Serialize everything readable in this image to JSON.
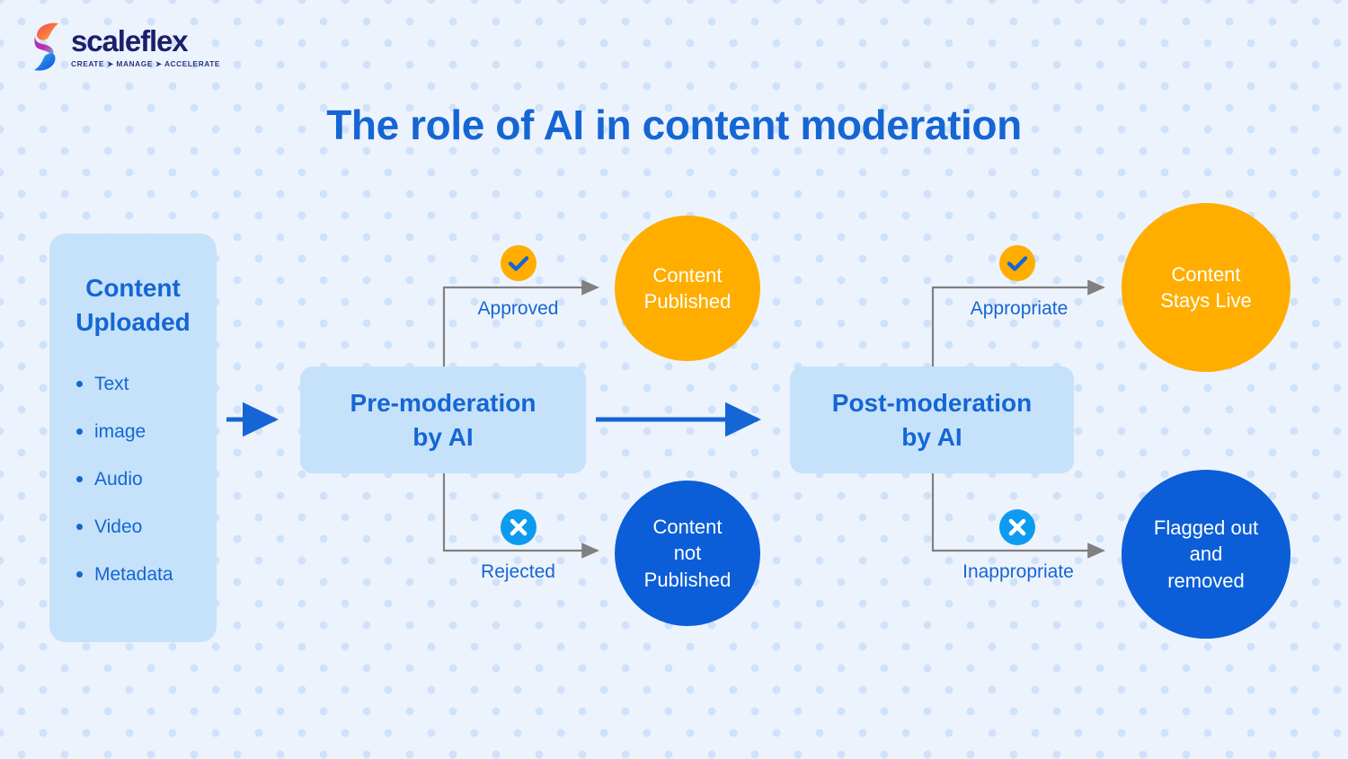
{
  "brand": {
    "logo_icon": "scaleflex-s-logo-icon",
    "wordmark": "scaleflex",
    "tagline": "CREATE ➤ MANAGE ➤ ACCELERATE"
  },
  "page": {
    "title": "The role of AI in content moderation",
    "background_color": "#EDF3FD",
    "dot_color": "#CFE2FA"
  },
  "colors": {
    "primary_blue": "#1566D4",
    "deep_blue": "#0B5ED7",
    "light_blue_fill": "#C6E2FA",
    "orange": "#FFAE00",
    "cyan": "#0D9BF0",
    "connector_gray": "#808080",
    "white": "#FFFFFF"
  },
  "content_card": {
    "title": "Content\nUploaded",
    "title_line1": "Content",
    "title_line2": "Uploaded",
    "items": [
      {
        "label": "Text"
      },
      {
        "label": "image"
      },
      {
        "label": "Audio"
      },
      {
        "label": "Video"
      },
      {
        "label": "Metadata"
      }
    ]
  },
  "process_steps": [
    {
      "id": "pre-moderation",
      "line1": "Pre-moderation",
      "line2": "by AI"
    },
    {
      "id": "post-moderation",
      "line1": "Post-moderation",
      "line2": "by AI"
    }
  ],
  "branches": [
    {
      "id": "approved",
      "from": "pre-moderation",
      "label": "Approved",
      "icon": "check-circle-icon",
      "icon_circle_color": "#FFAE00",
      "icon_glyph_color": "#1566D4",
      "outcome_line1": "Content",
      "outcome_line2": "Published",
      "outcome_line3": "",
      "outcome_color": "#FFAE00"
    },
    {
      "id": "rejected",
      "from": "pre-moderation",
      "label": "Rejected",
      "icon": "x-circle-icon",
      "icon_circle_color": "#0D9BF0",
      "icon_glyph_color": "#FFFFFF",
      "outcome_line1": "Content",
      "outcome_line2": "not",
      "outcome_line3": "Published",
      "outcome_color": "#0B5ED7"
    },
    {
      "id": "appropriate",
      "from": "post-moderation",
      "label": "Appropriate",
      "icon": "check-circle-icon",
      "icon_circle_color": "#FFAE00",
      "icon_glyph_color": "#1566D4",
      "outcome_line1": "Content",
      "outcome_line2": "Stays Live",
      "outcome_line3": "",
      "outcome_color": "#FFAE00"
    },
    {
      "id": "inappropriate",
      "from": "post-moderation",
      "label": "Inappropriate",
      "icon": "x-circle-icon",
      "icon_circle_color": "#0D9BF0",
      "icon_glyph_color": "#FFFFFF",
      "outcome_line1": "Flagged out",
      "outcome_line2": "and",
      "outcome_line3": "removed",
      "outcome_color": "#0B5ED7"
    }
  ],
  "flow_arrows": [
    {
      "id": "content-to-pre",
      "color": "#1566D4"
    },
    {
      "id": "pre-to-post",
      "color": "#1566D4"
    }
  ]
}
